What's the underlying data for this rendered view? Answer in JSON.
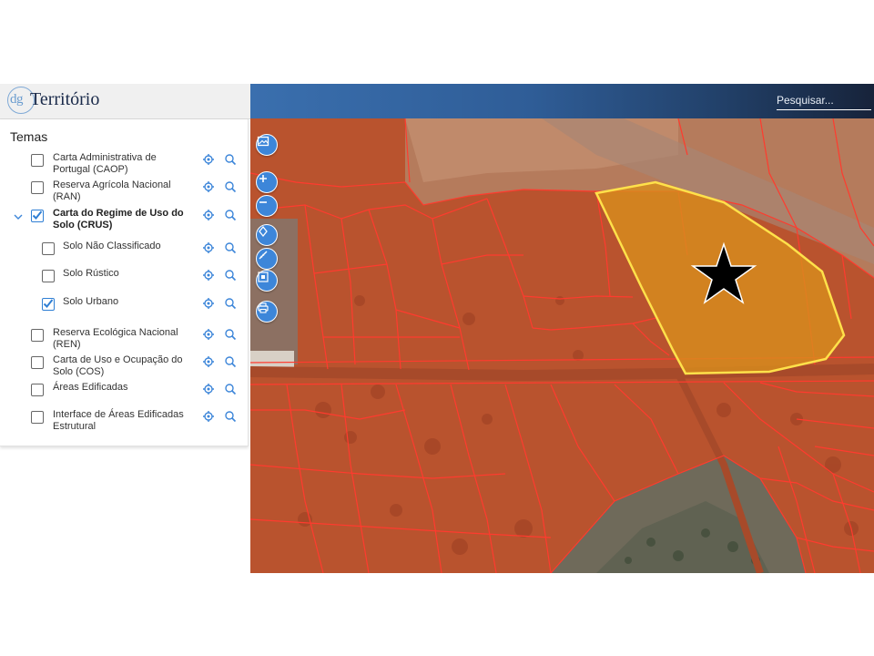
{
  "app": {
    "logo_prefix": "dg",
    "logo_text": "Território"
  },
  "search": {
    "placeholder": "Pesquisar..."
  },
  "panel": {
    "title": "Temas",
    "layers": [
      {
        "label": "Carta Administrativa de Portugal (CAOP)",
        "checked": false,
        "bold": false,
        "indent": false
      },
      {
        "label": "Reserva Agrícola Nacional (RAN)",
        "checked": false,
        "bold": false,
        "indent": false
      },
      {
        "label": "Carta do Regime de Uso do Solo (CRUS)",
        "checked": true,
        "bold": true,
        "indent": false,
        "expanded": true
      },
      {
        "label": "Solo Não Classificado",
        "checked": false,
        "bold": false,
        "indent": true
      },
      {
        "label": "Solo Rústico",
        "checked": false,
        "bold": false,
        "indent": true
      },
      {
        "label": "Solo Urbano",
        "checked": true,
        "bold": false,
        "indent": true
      },
      {
        "label": "Reserva Ecológica Nacional (REN)",
        "checked": false,
        "bold": false,
        "indent": false
      },
      {
        "label": "Carta de Uso e Ocupação do Solo (COS)",
        "checked": false,
        "bold": false,
        "indent": false
      },
      {
        "label": "Áreas Edificadas",
        "checked": false,
        "bold": false,
        "indent": false
      },
      {
        "label": "Interface de Áreas Edificadas Estrutural",
        "checked": false,
        "bold": false,
        "indent": false
      }
    ]
  },
  "map_controls": [
    {
      "name": "basemap-button",
      "icon": "image-icon"
    },
    {
      "name": "zoom-in-button",
      "icon": "plus-icon"
    },
    {
      "name": "zoom-out-button",
      "icon": "minus-icon"
    },
    {
      "name": "locate-button",
      "icon": "location-icon"
    },
    {
      "name": "measure-button",
      "icon": "ruler-icon"
    },
    {
      "name": "extent-button",
      "icon": "extent-icon"
    },
    {
      "name": "print-button",
      "icon": "printer-icon"
    }
  ],
  "colors": {
    "accent": "#3d86d9",
    "crus_overlay": "#c0441f",
    "parcel_lines": "#ff3b2e",
    "selected_parcel_fill": "#d9901c",
    "selected_parcel_border": "#ffe14a"
  },
  "map": {
    "marker_icon": "star-icon",
    "layer_shown": "Solo Urbano"
  }
}
